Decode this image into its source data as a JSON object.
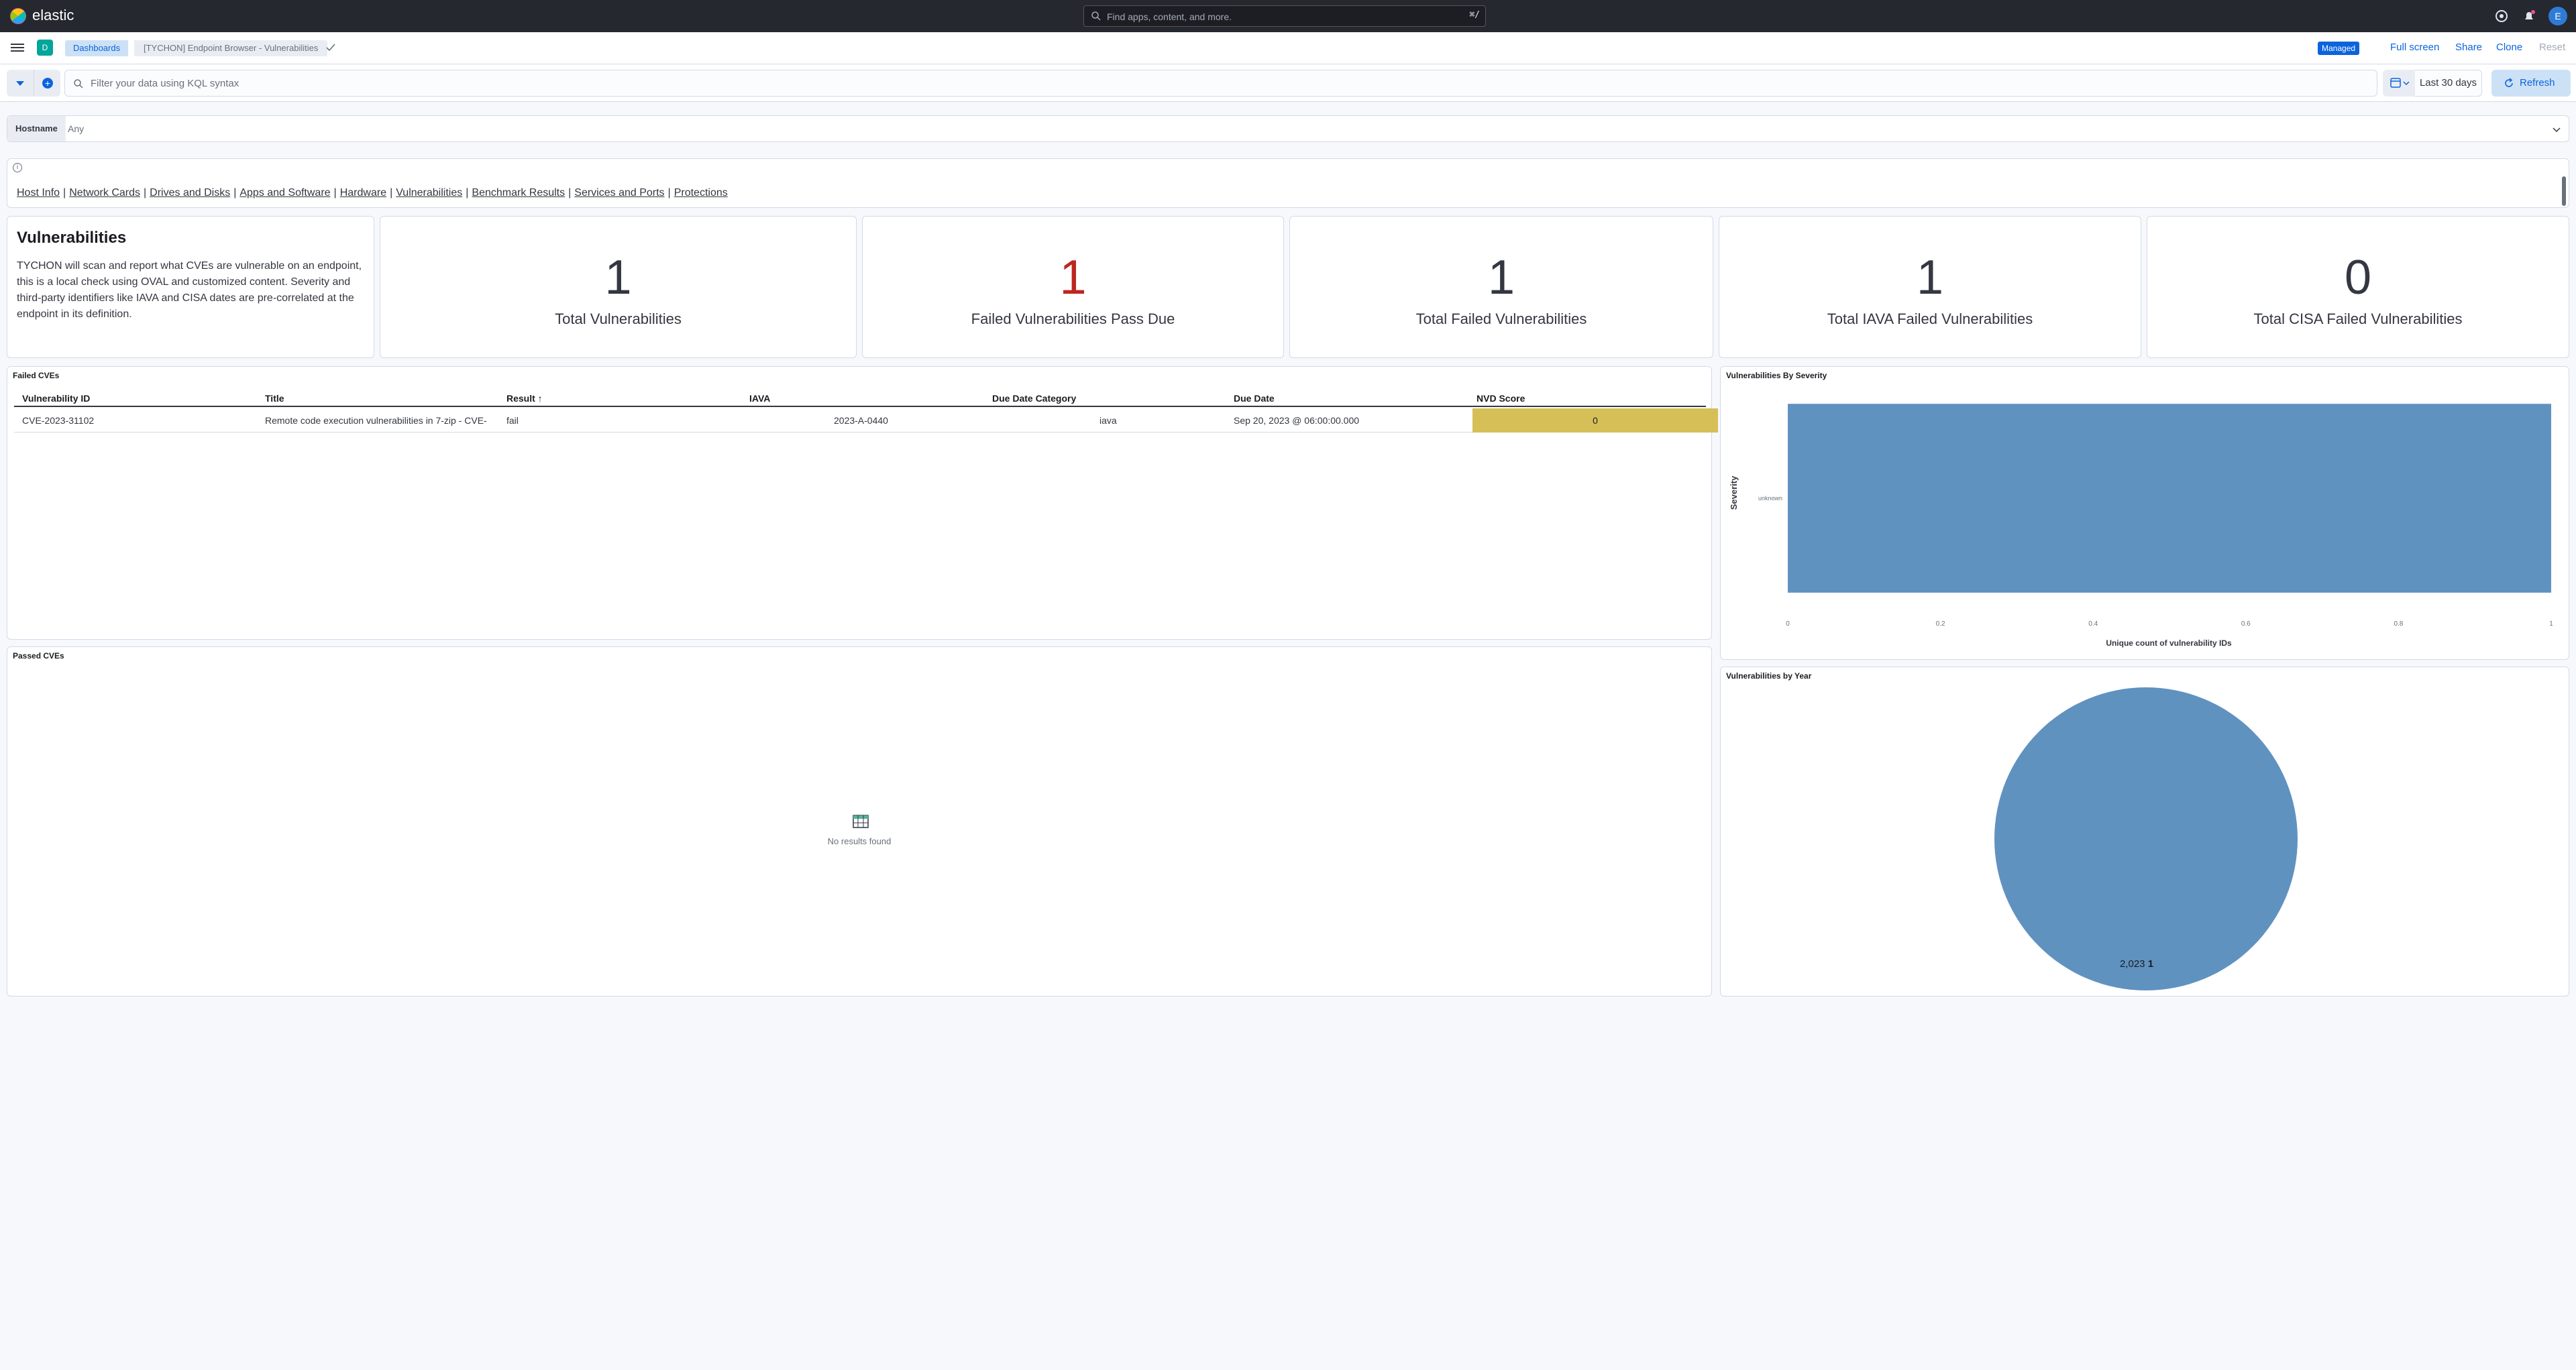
{
  "app": {
    "logo_text": "elastic",
    "search_placeholder": "Find apps, content, and more.",
    "search_shortcut": "⌘/",
    "avatar_initial": "E"
  },
  "breadcrumbs": {
    "space_initial": "D",
    "dashboards": "Dashboards",
    "current": "[TYCHON] Endpoint Browser - Vulnerabilities"
  },
  "toolbar": {
    "managed_badge": "Managed",
    "full_screen": "Full screen",
    "share": "Share",
    "clone": "Clone",
    "reset": "Reset"
  },
  "query": {
    "placeholder": "Filter your data using KQL syntax",
    "date_range": "Last 30 days",
    "refresh": "Refresh"
  },
  "controls": {
    "hostname_label": "Hostname",
    "hostname_value": "Any"
  },
  "nav_links": [
    "Host Info",
    "Network Cards",
    "Drives and Disks",
    "Apps and Software",
    "Hardware",
    "Vulnerabilities",
    "Benchmark Results",
    "Services and Ports",
    "Protections"
  ],
  "intro": {
    "title": "Vulnerabilities",
    "body": "TYCHON will scan and report what CVEs are vulnerable on an endpoint, this is a local check using OVAL and customized content. Severity and third-party identifiers like IAVA and CISA dates are pre-correlated at the endpoint in its definition."
  },
  "metrics": [
    {
      "value": "1",
      "label": "Total Vulnerabilities"
    },
    {
      "value": "1",
      "label": "Failed Vulnerabilities Pass Due"
    },
    {
      "value": "1",
      "label": "Total Failed Vulnerabilities"
    },
    {
      "value": "1",
      "label": "Total IAVA Failed Vulnerabilities"
    },
    {
      "value": "0",
      "label": "Total CISA Failed Vulnerabilities"
    }
  ],
  "failed_cves": {
    "title": "Failed CVEs",
    "columns": [
      "Vulnerability ID",
      "Title",
      "Result ↑",
      "IAVA",
      "Due Date Category",
      "Due Date",
      "NVD Score"
    ],
    "rows": [
      {
        "id": "CVE-2023-31102",
        "title": "Remote code execution vulnerabilities in 7-zip - CVE-",
        "result": "fail",
        "iava": "2023-A-0440",
        "due_category": "iava",
        "due_date": "Sep 20, 2023 @ 06:00:00.000",
        "nvd_score": "0"
      }
    ]
  },
  "passed_cves": {
    "title": "Passed CVEs",
    "empty_text": "No results found"
  },
  "severity_chart": {
    "panel_title": "Vulnerabilities By Severity",
    "colors": {
      "bar": "#6092c0"
    }
  },
  "year_chart": {
    "panel_title": "Vulnerabilities by Year",
    "slice_label_value": "2,023",
    "slice_label_count": "1",
    "colors": {
      "slice": "#6092c0"
    }
  },
  "chart_data": [
    {
      "type": "bar",
      "orientation": "horizontal",
      "categories": [
        "unknown"
      ],
      "values": [
        1
      ],
      "ylabel": "Severity",
      "xlabel": "Unique count of vulnerability IDs",
      "xlim": [
        0,
        1
      ],
      "xticks": [
        "0",
        "0.2",
        "0.4",
        "0.6",
        "0.8",
        "1"
      ],
      "grid": false
    },
    {
      "type": "pie",
      "labels": [
        "2,023"
      ],
      "values": [
        1
      ]
    }
  ]
}
